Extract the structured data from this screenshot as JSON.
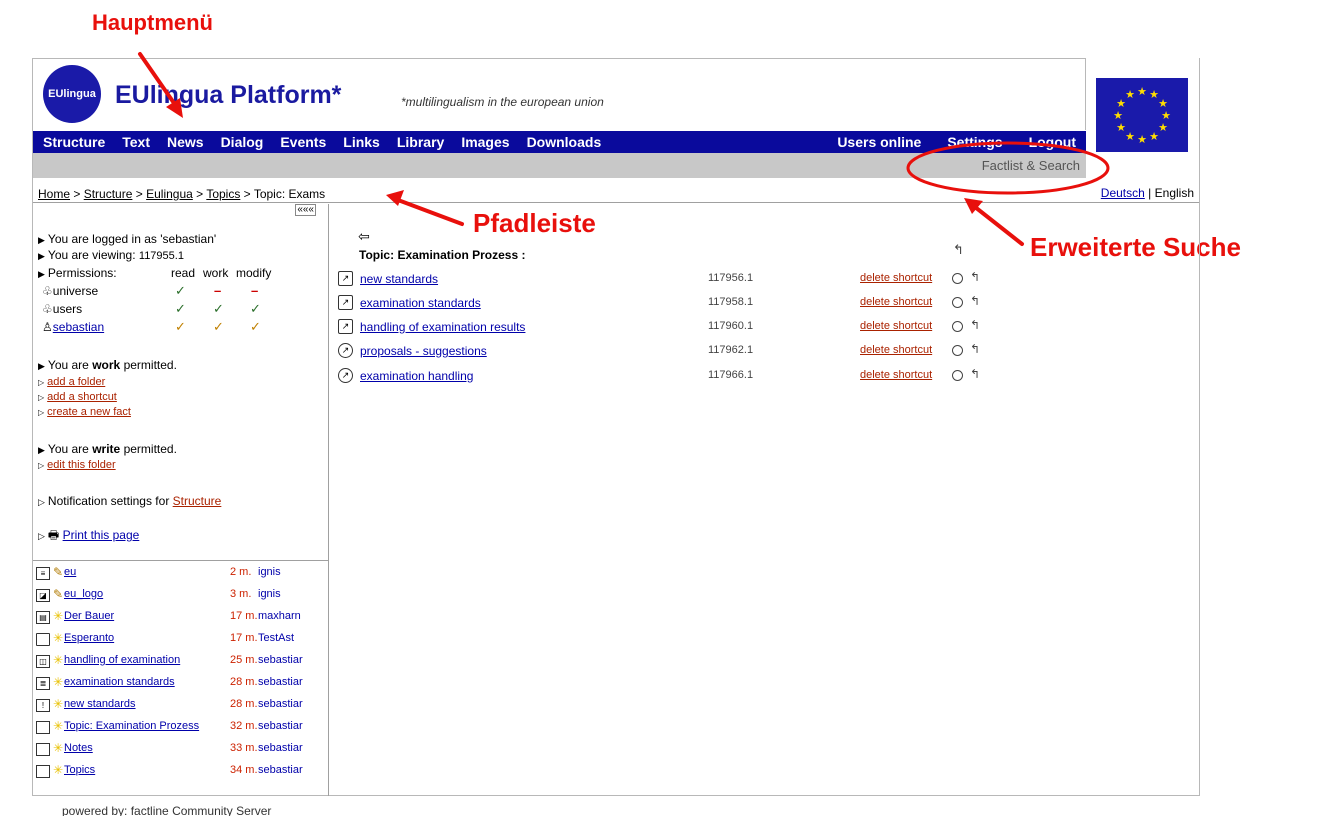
{
  "annotations": {
    "main_menu": "Hauptmenü",
    "breadcrumb_bar": "Pfadleiste",
    "advanced_search": "Erweiterte Suche"
  },
  "header": {
    "logo_text": "EUlingua",
    "title": "EUlingua Platform*",
    "slogan": "*multilingualism in the european union"
  },
  "menu": {
    "left": [
      "Structure",
      "Text",
      "News",
      "Dialog",
      "Events",
      "Links",
      "Library",
      "Images",
      "Downloads"
    ],
    "right": [
      "Users online",
      "Settings",
      "Logout"
    ]
  },
  "subbar": {
    "factlist_search": "Factlist & Search"
  },
  "breadcrumb": {
    "items": [
      "Home",
      "Structure",
      "Eulingua",
      "Topics"
    ],
    "separator": ">",
    "current": "Topic: Exams"
  },
  "language": {
    "deutsch": "Deutsch",
    "separator": "|",
    "english": "English"
  },
  "left_panel": {
    "collapse_icon": "«««",
    "logged_in": "You are logged in as 'sebastian'",
    "viewing_label": "You are viewing:",
    "viewing_id": "117955.1",
    "permissions_label": "Permissions:",
    "perm_headers": [
      "read",
      "work",
      "modify"
    ],
    "perm_rows": [
      {
        "name": "universe",
        "marks": [
          "✓",
          "–",
          "–"
        ]
      },
      {
        "name": "users",
        "marks": [
          "✓",
          "✓",
          "✓"
        ]
      },
      {
        "name": "sebastian",
        "marks": [
          "✓",
          "✓",
          "✓"
        ]
      }
    ],
    "work_prefix": "You are",
    "work_word": "work",
    "work_suffix": "permitted.",
    "work_links": [
      "add a folder",
      "add a shortcut",
      "create a new fact"
    ],
    "write_prefix": "You are",
    "write_word": "write",
    "write_suffix": "permitted.",
    "write_links": [
      "edit this folder"
    ],
    "notification_label": "Notification settings for",
    "notification_link": "Structure",
    "print_link": "Print this page"
  },
  "recent": [
    {
      "icon": "list-icon",
      "name": "eu",
      "time": "2 m.",
      "user": "ignis"
    },
    {
      "icon": "image-icon",
      "name": "eu_logo",
      "time": "3 m.",
      "user": "ignis"
    },
    {
      "icon": "doc-icon",
      "name": "Der Bauer",
      "time": "17 m.",
      "user": "maxharn"
    },
    {
      "icon": "folder-icon",
      "name": "Esperanto",
      "time": "17 m.",
      "user": "TestAst"
    },
    {
      "icon": "book-icon",
      "name": "handling of examination",
      "time": "25 m.",
      "user": "sebastiar"
    },
    {
      "icon": "text-icon",
      "name": "examination standards",
      "time": "28 m.",
      "user": "sebastiar"
    },
    {
      "icon": "news-icon",
      "name": "new standards",
      "time": "28 m.",
      "user": "sebastiar"
    },
    {
      "icon": "folder-icon",
      "name": "Topic: Examination Prozess",
      "time": "32 m.",
      "user": "sebastiar"
    },
    {
      "icon": "folder-icon",
      "name": "Notes",
      "time": "33 m.",
      "user": "sebastiar"
    },
    {
      "icon": "folder-icon",
      "name": "Topics",
      "time": "34 m.",
      "user": "sebastiar"
    }
  ],
  "main": {
    "back_icon": "⇦",
    "topic_title": "Topic: Examination Prozess :",
    "rows": [
      {
        "name": "new standards",
        "id": "117956.1",
        "action": "delete shortcut"
      },
      {
        "name": "examination standards",
        "id": "117958.1",
        "action": "delete shortcut"
      },
      {
        "name": "handling of examination results",
        "id": "117960.1",
        "action": "delete shortcut"
      },
      {
        "name": "proposals - suggestions",
        "id": "117962.1",
        "action": "delete shortcut"
      },
      {
        "name": "examination handling",
        "id": "117966.1",
        "action": "delete shortcut"
      }
    ]
  },
  "footer": "powered by: factline Community Server",
  "colors": {
    "menu_bg": "#0a0a9c",
    "annotation_red": "#e8100c",
    "title_blue": "#1a1aa0"
  }
}
